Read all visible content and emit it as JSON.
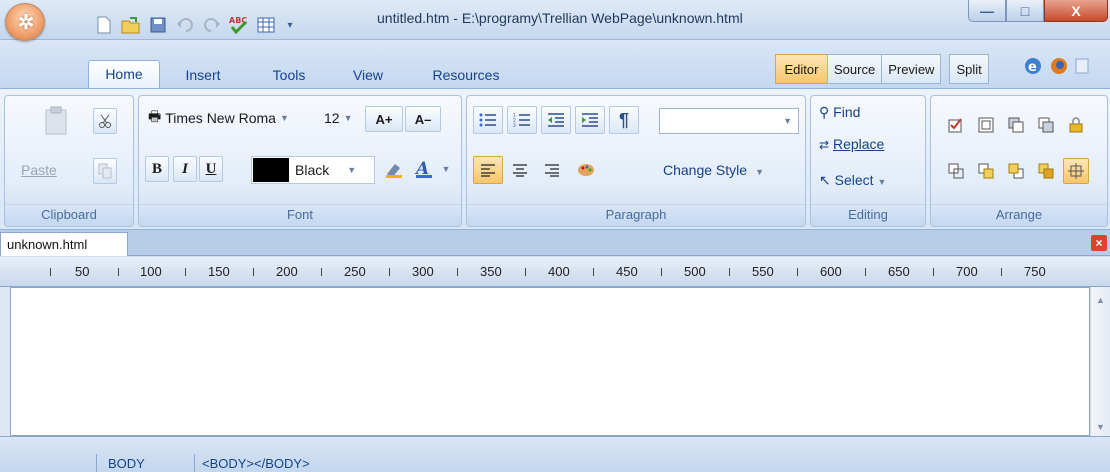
{
  "window": {
    "title": "untitled.htm - E:\\programy\\Trellian WebPage\\unknown.html",
    "minimize": "—",
    "maximize": "□",
    "close": "X"
  },
  "ribbon_tabs": [
    {
      "label": "Home"
    },
    {
      "label": "Insert"
    },
    {
      "label": "Tools"
    },
    {
      "label": "View"
    },
    {
      "label": "Resources"
    }
  ],
  "view_tabs": {
    "editor": "Editor",
    "source": "Source",
    "preview": "Preview",
    "split": "Split"
  },
  "clipboard": {
    "paste": "Paste",
    "group": "Clipboard"
  },
  "font": {
    "family": "Times New Roma",
    "size": "12",
    "grow": "A+",
    "shrink": "A–",
    "bold": "B",
    "italic": "I",
    "underline": "U",
    "color_name": "Black",
    "color_swatch": "#000000",
    "group": "Font"
  },
  "paragraph": {
    "pilcrow": "¶",
    "change_style": "Change Style",
    "group": "Paragraph"
  },
  "editing": {
    "find": "Find",
    "replace": "Replace",
    "select": "Select",
    "group": "Editing"
  },
  "arrange": {
    "group": "Arrange"
  },
  "document": {
    "tab": "unknown.html"
  },
  "ruler": {
    "marks": [
      "50",
      "100",
      "150",
      "200",
      "250",
      "300",
      "350",
      "400",
      "450",
      "500",
      "550",
      "600",
      "650",
      "700",
      "750"
    ]
  },
  "status": {
    "element": "BODY",
    "path": "<BODY></BODY>"
  },
  "colors": {
    "accent": "#15428b",
    "ribbon_bg": "#d8e6f6",
    "editor_tab": "#f7c56a"
  }
}
